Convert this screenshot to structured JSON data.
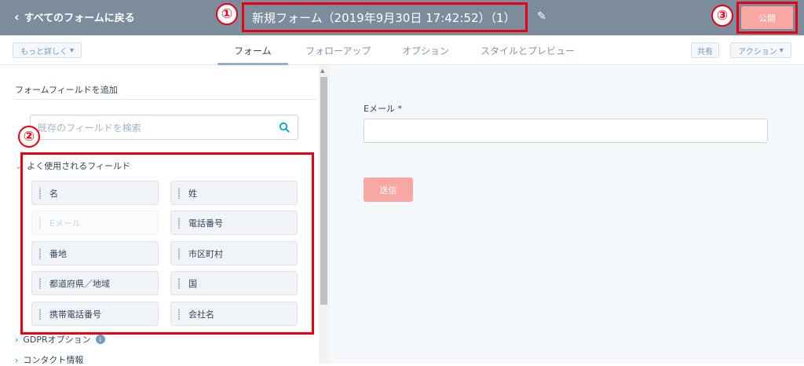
{
  "header": {
    "back_label": "すべてのフォームに戻る",
    "form_title": "新規フォーム（2019年9月30日 17:42:52）（1）",
    "publish_label": "公開",
    "badges": [
      "①",
      "②",
      "③"
    ]
  },
  "toolbar": {
    "more_label": "もっと詳しく",
    "tabs": [
      "フォーム",
      "フォローアップ",
      "オプション",
      "スタイルとプレビュー"
    ],
    "share_label": "共有",
    "actions_label": "アクション"
  },
  "left_panel": {
    "heading": "フォームフィールドを追加",
    "search_placeholder": "既存のフィールドを検索",
    "frequent_section": "よく使用されるフィールド",
    "fields": [
      {
        "label": "名",
        "disabled": false
      },
      {
        "label": "姓",
        "disabled": false
      },
      {
        "label": "Eメール",
        "disabled": true
      },
      {
        "label": "電話番号",
        "disabled": false
      },
      {
        "label": "番地",
        "disabled": false
      },
      {
        "label": "市区町村",
        "disabled": false
      },
      {
        "label": "都道府県／地域",
        "disabled": false
      },
      {
        "label": "国",
        "disabled": false
      },
      {
        "label": "携帯電話番号",
        "disabled": false
      },
      {
        "label": "会社名",
        "disabled": false
      }
    ],
    "gdpr_section": "GDPRオプション",
    "gdpr_info_icon": "i",
    "contact_section": "コンタクト情報"
  },
  "preview": {
    "email_label": "Eメール *",
    "submit_label": "送信"
  },
  "colors": {
    "topbar": "#7c8c9c",
    "accent_red": "#e60012",
    "publish": "#f8a7a3"
  }
}
